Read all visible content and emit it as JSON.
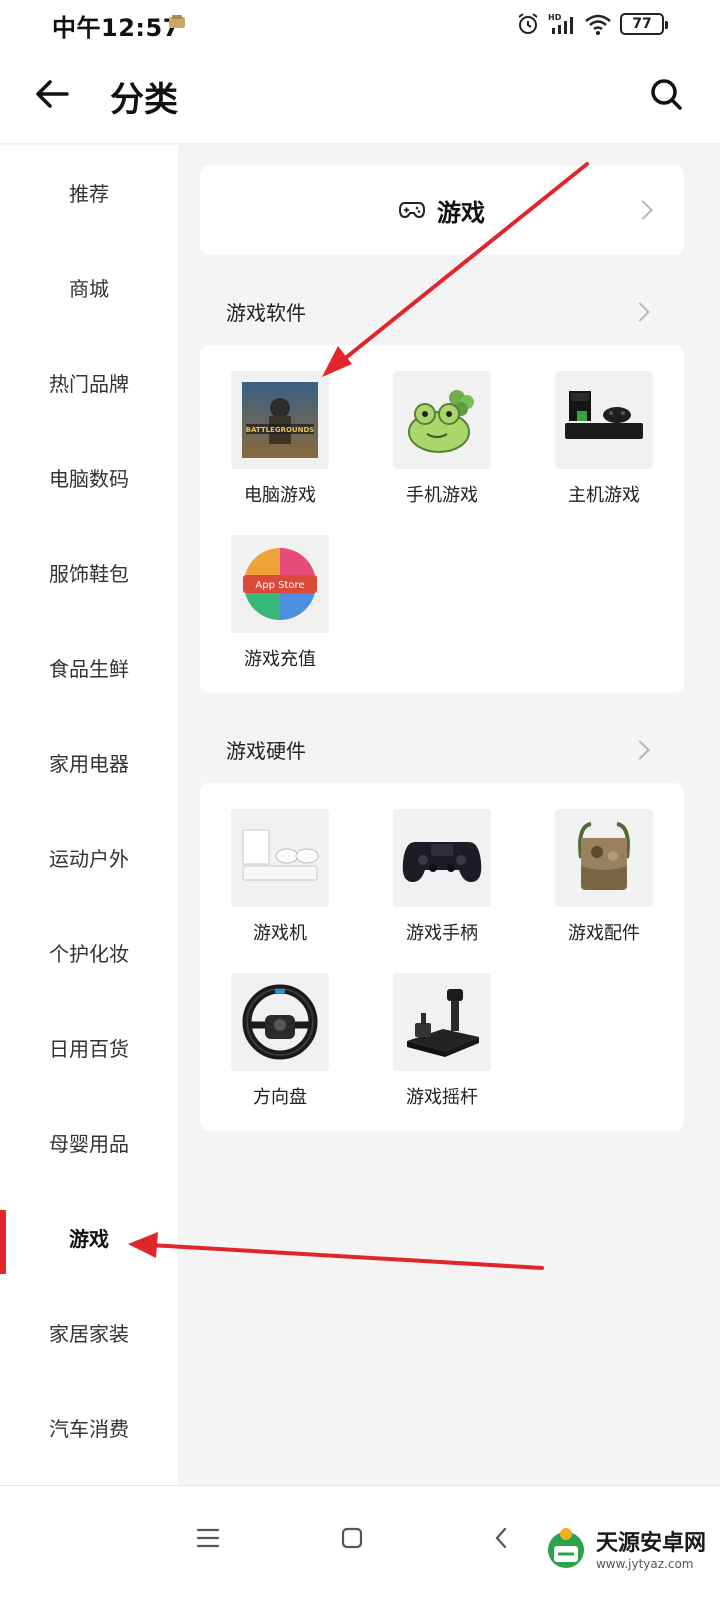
{
  "status_bar": {
    "time": "中午12:57",
    "battery": "77",
    "network_label": "HD"
  },
  "header": {
    "title": "分类",
    "back_icon": "arrow-left-icon",
    "search_icon": "search-icon"
  },
  "sidebar": {
    "items": [
      {
        "label": "推荐"
      },
      {
        "label": "商城"
      },
      {
        "label": "热门品牌"
      },
      {
        "label": "电脑数码"
      },
      {
        "label": "服饰鞋包"
      },
      {
        "label": "食品生鲜"
      },
      {
        "label": "家用电器"
      },
      {
        "label": "运动户外"
      },
      {
        "label": "个护化妆"
      },
      {
        "label": "日用百货"
      },
      {
        "label": "母婴用品"
      },
      {
        "label": "游戏"
      },
      {
        "label": "家居家装"
      },
      {
        "label": "汽车消费"
      }
    ],
    "active_label": "游戏"
  },
  "category": {
    "title": "游戏",
    "icon": "gamepad-icon"
  },
  "sections": [
    {
      "title": "游戏软件",
      "items": [
        {
          "label": "电脑游戏",
          "icon": "pubg-cover"
        },
        {
          "label": "手机游戏",
          "icon": "frog-image"
        },
        {
          "label": "主机游戏",
          "icon": "xbox-console-image"
        },
        {
          "label": "游戏充值",
          "icon": "app-store-card"
        }
      ]
    },
    {
      "title": "游戏硬件",
      "items": [
        {
          "label": "游戏机",
          "icon": "white-console-image"
        },
        {
          "label": "游戏手柄",
          "icon": "controller-image"
        },
        {
          "label": "游戏配件",
          "icon": "bag-image"
        },
        {
          "label": "方向盘",
          "icon": "steering-wheel-image"
        },
        {
          "label": "游戏摇杆",
          "icon": "joystick-image"
        }
      ]
    }
  ],
  "thumb_texts": {
    "app_store": "App Store",
    "pubg": "BATTLEGROUNDS"
  },
  "watermark": {
    "title": "天源安卓网",
    "url": "www.jytyaz.com"
  },
  "colors": {
    "accent": "#e0262b",
    "arrow": "#e0262b",
    "background": "#f4f4f4"
  }
}
